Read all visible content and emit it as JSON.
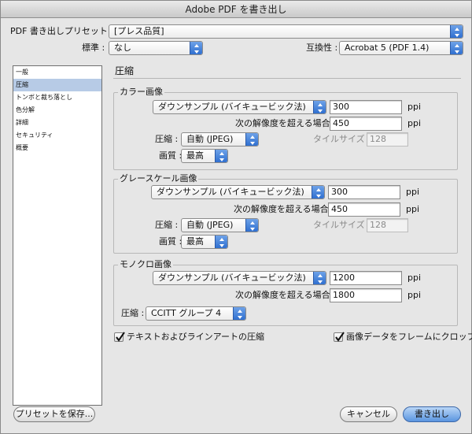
{
  "window": {
    "title": "Adobe PDF を書き出し"
  },
  "preset": {
    "label": "PDF 書き出しプリセット :",
    "value": "[プレス品質]"
  },
  "standard": {
    "label": "標準 :",
    "value": "なし"
  },
  "compatibility": {
    "label": "互換性 :",
    "value": "Acrobat 5 (PDF 1.4)"
  },
  "sidebar": {
    "items": [
      {
        "label": "一般"
      },
      {
        "label": "圧縮"
      },
      {
        "label": "トンボと裁ち落とし"
      },
      {
        "label": "色分解"
      },
      {
        "label": "詳細"
      },
      {
        "label": "セキュリティ"
      },
      {
        "label": "概要"
      }
    ],
    "selected_index": 1
  },
  "panel": {
    "title": "圧縮"
  },
  "color_images": {
    "title": "カラー画像",
    "downsample": "ダウンサンプル (バイキュービック法)",
    "resolution": "300",
    "resolution_unit": "ppi",
    "threshold_label": "次の解像度を超える場合 :",
    "threshold": "450",
    "threshold_unit": "ppi",
    "compression_label": "圧縮 :",
    "compression": "自動 (JPEG)",
    "tile_label": "タイルサイズ :",
    "tile_size": "128",
    "quality_label": "画質 :",
    "quality": "最高"
  },
  "grayscale_images": {
    "title": "グレースケール画像",
    "downsample": "ダウンサンプル (バイキュービック法)",
    "resolution": "300",
    "resolution_unit": "ppi",
    "threshold_label": "次の解像度を超える場合 :",
    "threshold": "450",
    "threshold_unit": "ppi",
    "compression_label": "圧縮 :",
    "compression": "自動 (JPEG)",
    "tile_label": "タイルサイズ :",
    "tile_size": "128",
    "quality_label": "画質 :",
    "quality": "最高"
  },
  "mono_images": {
    "title": "モノクロ画像",
    "downsample": "ダウンサンプル (バイキュービック法)",
    "resolution": "1200",
    "resolution_unit": "ppi",
    "threshold_label": "次の解像度を超える場合 :",
    "threshold": "1800",
    "threshold_unit": "ppi",
    "compression_label": "圧縮 :",
    "compression": "CCITT グループ 4"
  },
  "options": {
    "compress_text": {
      "label": "テキストおよびラインアートの圧縮",
      "checked": true
    },
    "crop_images": {
      "label": "画像データをフレームにクロップ",
      "checked": true
    }
  },
  "buttons": {
    "save_preset": "プリセットを保存...",
    "cancel": "キャンセル",
    "export": "書き出し"
  },
  "colors": {
    "accent": "#2f6fd0",
    "selected_row": "#b7cbe6"
  }
}
